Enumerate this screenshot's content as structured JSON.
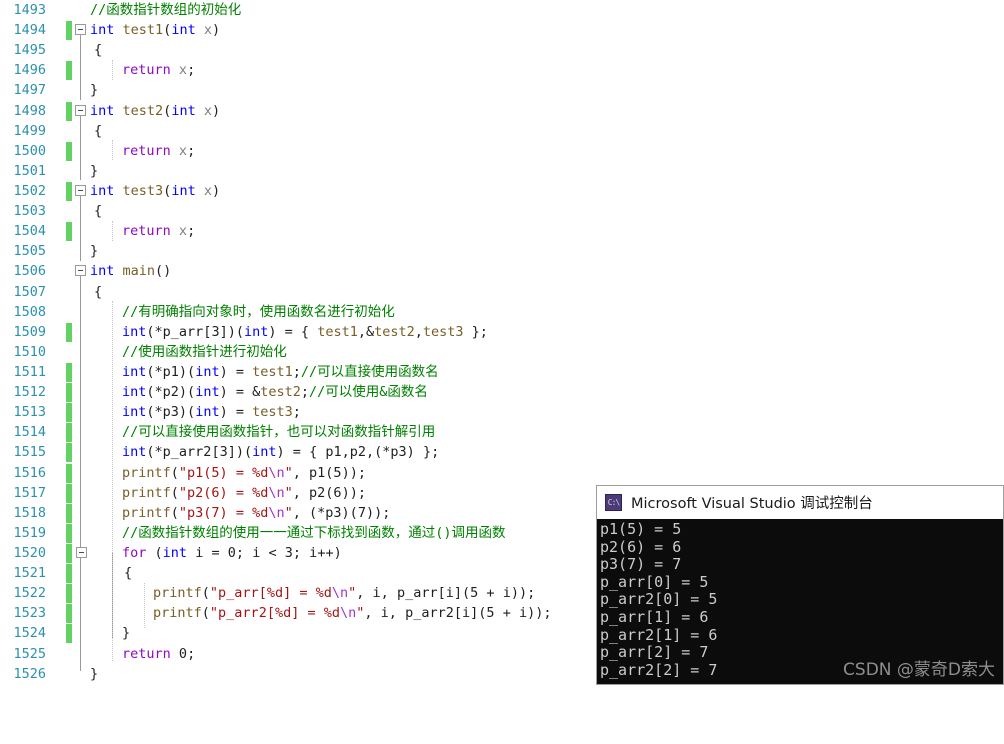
{
  "editor": {
    "first_line_number": 1493,
    "line_numbers": [
      1493,
      1494,
      1495,
      1496,
      1497,
      1498,
      1499,
      1500,
      1501,
      1502,
      1503,
      1504,
      1505,
      1506,
      1507,
      1508,
      1509,
      1510,
      1511,
      1512,
      1513,
      1514,
      1515,
      1516,
      1517,
      1518,
      1519,
      1520,
      1521,
      1522,
      1523,
      1524,
      1525,
      1526
    ],
    "colors": {
      "line_number": "#2B91AF",
      "comment": "#008000",
      "keyword": "#0000FF",
      "function": "#795E26",
      "string": "#A31515",
      "escape": "#A333C8",
      "control_keyword": "#8F08C4",
      "change_bar": "#62D262",
      "background": "#FFFFFF"
    },
    "lines": [
      {
        "n": 1493,
        "text": "//函数指针数组的初始化"
      },
      {
        "n": 1494,
        "text": "int test1(int x)"
      },
      {
        "n": 1495,
        "text": "{"
      },
      {
        "n": 1496,
        "text": "    return x;"
      },
      {
        "n": 1497,
        "text": "}"
      },
      {
        "n": 1498,
        "text": "int test2(int x)"
      },
      {
        "n": 1499,
        "text": "{"
      },
      {
        "n": 1500,
        "text": "    return x;"
      },
      {
        "n": 1501,
        "text": "}"
      },
      {
        "n": 1502,
        "text": "int test3(int x)"
      },
      {
        "n": 1503,
        "text": "{"
      },
      {
        "n": 1504,
        "text": "    return x;"
      },
      {
        "n": 1505,
        "text": "}"
      },
      {
        "n": 1506,
        "text": "int main()"
      },
      {
        "n": 1507,
        "text": "{"
      },
      {
        "n": 1508,
        "text": "    //有明确指向对象时，使用函数名进行初始化"
      },
      {
        "n": 1509,
        "text": "    int(*p_arr[3])(int) = { test1,&test2,test3 };"
      },
      {
        "n": 1510,
        "text": "    //使用函数指针进行初始化"
      },
      {
        "n": 1511,
        "text": "    int(*p1)(int) = test1;//可以直接使用函数名"
      },
      {
        "n": 1512,
        "text": "    int(*p2)(int) = &test2;//可以使用&函数名"
      },
      {
        "n": 1513,
        "text": "    int(*p3)(int) = test3;"
      },
      {
        "n": 1514,
        "text": "    //可以直接使用函数指针，也可以对函数指针解引用"
      },
      {
        "n": 1515,
        "text": "    int(*p_arr2[3])(int) = { p1,p2,(*p3) };"
      },
      {
        "n": 1516,
        "text": "    printf(\"p1(5) = %d\\n\", p1(5));"
      },
      {
        "n": 1517,
        "text": "    printf(\"p2(6) = %d\\n\", p2(6));"
      },
      {
        "n": 1518,
        "text": "    printf(\"p3(7) = %d\\n\", (*p3)(7));"
      },
      {
        "n": 1519,
        "text": "    //函数指针数组的使用一一通过下标找到函数，通过()调用函数"
      },
      {
        "n": 1520,
        "text": "    for (int i = 0; i < 3; i++)"
      },
      {
        "n": 1521,
        "text": "    {"
      },
      {
        "n": 1522,
        "text": "        printf(\"p_arr[%d] = %d\\n\", i, p_arr[i](5 + i));"
      },
      {
        "n": 1523,
        "text": "        printf(\"p_arr2[%d] = %d\\n\", i, p_arr2[i](5 + i));"
      },
      {
        "n": 1524,
        "text": "    }"
      },
      {
        "n": 1525,
        "text": "    return 0;"
      },
      {
        "n": 1526,
        "text": "}"
      }
    ]
  },
  "console": {
    "title": "Microsoft Visual Studio 调试控制台",
    "icon": "console-app-icon",
    "icon_glyph": "C:\\",
    "background": "#0C0C0C",
    "text_color": "#CCCCCC",
    "output": [
      "p1(5) = 5",
      "p2(6) = 6",
      "p3(7) = 7",
      "p_arr[0] = 5",
      "p_arr2[0] = 5",
      "p_arr[1] = 6",
      "p_arr2[1] = 6",
      "p_arr[2] = 7",
      "p_arr2[2] = 7"
    ],
    "watermark": "CSDN @蒙奇D索大"
  }
}
